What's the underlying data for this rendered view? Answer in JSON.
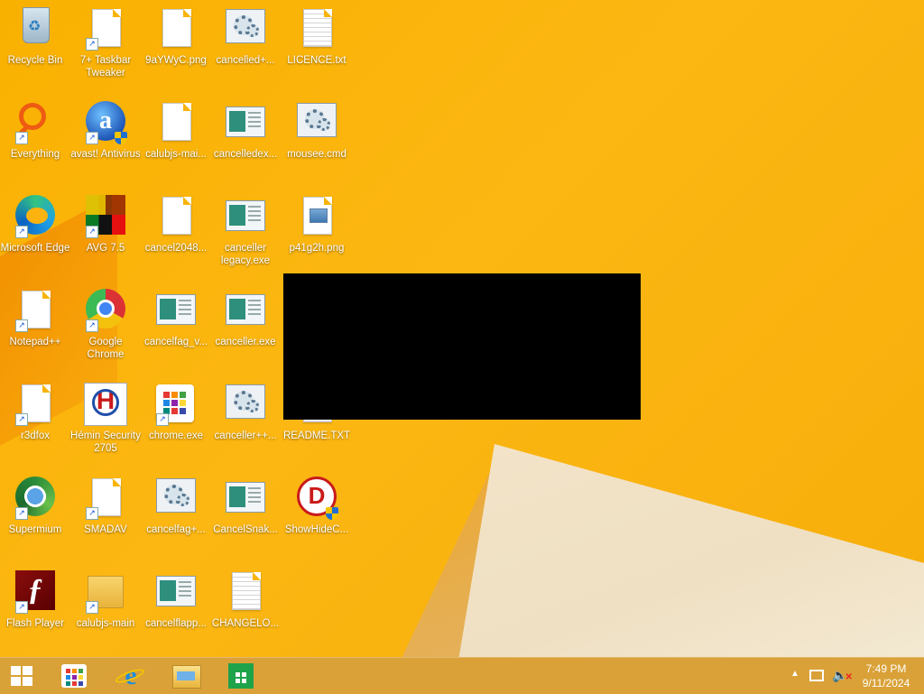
{
  "desktop": {
    "icons": [
      {
        "label": "Recycle Bin",
        "icon": "recycle-bin-icon",
        "shortcut": false
      },
      {
        "label": "7+ Taskbar Tweaker",
        "icon": "file-icon",
        "shortcut": true
      },
      {
        "label": "9aYWyC.png",
        "icon": "file-icon",
        "shortcut": false
      },
      {
        "label": "cancelled+...",
        "icon": "gear-window-icon",
        "shortcut": false
      },
      {
        "label": "LICENCE.txt",
        "icon": "text-file-icon",
        "shortcut": false
      },
      {
        "label": "Everything",
        "icon": "everything-search-icon",
        "shortcut": true
      },
      {
        "label": "avast! Antivirus",
        "icon": "avast-icon",
        "shortcut": true
      },
      {
        "label": "calubjs-mai...",
        "icon": "file-icon",
        "shortcut": false
      },
      {
        "label": "cancelledex...",
        "icon": "app-window-icon",
        "shortcut": false
      },
      {
        "label": "mousee.cmd",
        "icon": "gear-window-icon",
        "shortcut": false
      },
      {
        "label": "Microsoft Edge",
        "icon": "edge-icon",
        "shortcut": true
      },
      {
        "label": "AVG 7.5",
        "icon": "avg-icon",
        "shortcut": true
      },
      {
        "label": "cancel2048...",
        "icon": "file-icon",
        "shortcut": false
      },
      {
        "label": "canceller legacy.exe",
        "icon": "app-window-icon",
        "shortcut": false
      },
      {
        "label": "p41g2h.png",
        "icon": "image-file-icon",
        "shortcut": false
      },
      {
        "label": "Notepad++",
        "icon": "file-icon",
        "shortcut": true
      },
      {
        "label": "Google Chrome",
        "icon": "chrome-icon",
        "shortcut": true
      },
      {
        "label": "cancelfag_v...",
        "icon": "app-window-icon",
        "shortcut": false
      },
      {
        "label": "canceller.exe",
        "icon": "app-window-icon",
        "shortcut": false
      },
      {
        "label": "r3dfox",
        "icon": "file-icon",
        "shortcut": true
      },
      {
        "label": "Hémin Security 2705",
        "icon": "hemin-security-icon",
        "shortcut": false
      },
      {
        "label": "chrome.exe",
        "icon": "chrome-exe-icon",
        "shortcut": true
      },
      {
        "label": "canceller++...",
        "icon": "gear-window-icon",
        "shortcut": false
      },
      {
        "label": "README.TXT",
        "icon": "text-file-icon",
        "shortcut": false
      },
      {
        "label": "Supermium",
        "icon": "supermium-icon",
        "shortcut": true
      },
      {
        "label": "SMADAV",
        "icon": "file-icon",
        "shortcut": true
      },
      {
        "label": "cancelfag+...",
        "icon": "gear-window-icon",
        "shortcut": false
      },
      {
        "label": "CancelSnak...",
        "icon": "app-window-icon",
        "shortcut": false
      },
      {
        "label": "ShowHideC...",
        "icon": "showhide-icon",
        "shortcut": false
      },
      {
        "label": "Flash Player",
        "icon": "flash-icon",
        "shortcut": true
      },
      {
        "label": "calubjs-main",
        "icon": "folder-icon",
        "shortcut": true
      },
      {
        "label": "cancelflapp...",
        "icon": "app-window-icon",
        "shortcut": false
      },
      {
        "label": "CHANGELO...",
        "icon": "text-file-icon",
        "shortcut": false
      }
    ]
  },
  "taskbar": {
    "start_icon": "windows-logo-icon",
    "pinned": [
      {
        "name": "apps-tiles-icon"
      },
      {
        "name": "internet-explorer-icon"
      },
      {
        "name": "file-explorer-icon"
      },
      {
        "name": "store-icon"
      }
    ],
    "tray": {
      "time": "7:49 PM",
      "date": "9/11/2024"
    }
  }
}
